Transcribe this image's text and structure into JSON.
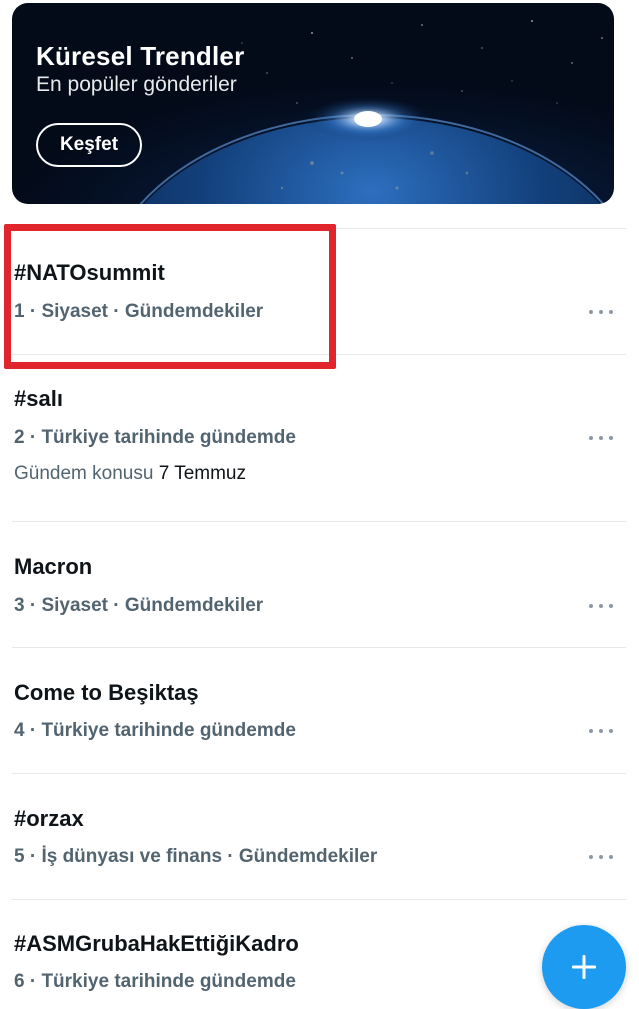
{
  "banner": {
    "title": "Küresel Trendler",
    "subtitle": "En popüler gönderiler",
    "button_label": "Keşfet"
  },
  "trends": [
    {
      "title": "#NATOsummit",
      "meta": "1 · Siyaset · Gündemdekiler"
    },
    {
      "title": "#salı",
      "meta": "2 · Türkiye tarihinde gündemde",
      "extra_prefix": "Gündem konusu",
      "extra_value": "7 Temmuz"
    },
    {
      "title": "Macron",
      "meta": "3 · Siyaset · Gündemdekiler"
    },
    {
      "title": "Come to Beşiktaş",
      "meta": "4 · Türkiye tarihinde gündemde"
    },
    {
      "title": "#orzax",
      "meta": "5 · İş dünyası ve finans · Gündemdekiler"
    },
    {
      "title": "#ASMGrubaHakEttiğiKadro",
      "meta": "6 · Türkiye tarihinde gündemde"
    }
  ],
  "highlight": {
    "target": "trend 1",
    "color": "#e0262c"
  },
  "fab": {
    "icon": "plus-icon",
    "color": "#1d9bf0"
  },
  "icons": {
    "more": "more-horizontal-icon"
  }
}
